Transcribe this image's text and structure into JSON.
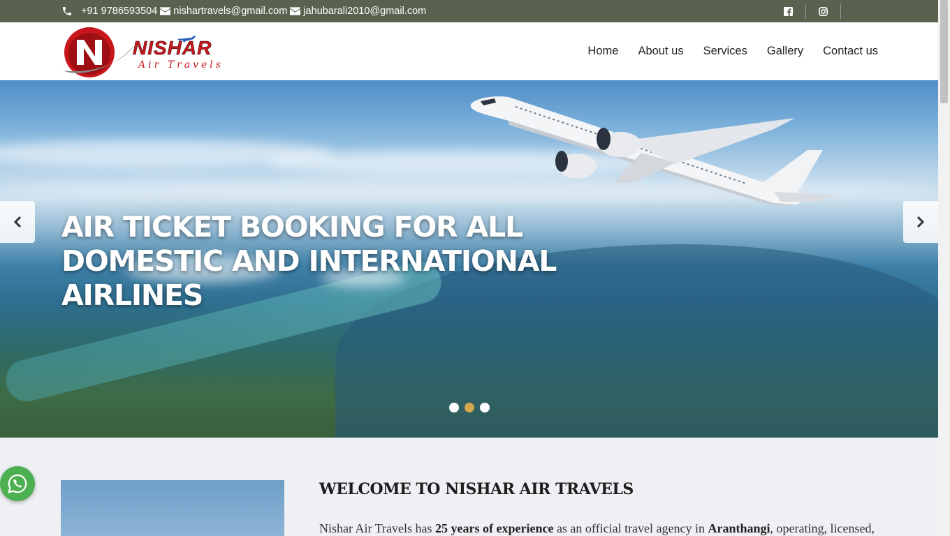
{
  "topbar": {
    "phone": "+91 9786593504",
    "email1": "nishartravels@gmail.com",
    "email2": "jahubarali2010@gmail.com",
    "social": [
      "facebook-icon",
      "instagram-icon"
    ]
  },
  "logo": {
    "brand": "NISHAR",
    "tagline": "Air Travels"
  },
  "nav": {
    "items": [
      "Home",
      "About us",
      "Services",
      "Gallery",
      "Contact us"
    ]
  },
  "hero": {
    "headline": "AIR TICKET BOOKING FOR ALL DOMESTIC AND INTERNATIONAL AIRLINES",
    "slides": 3,
    "active_slide": 2
  },
  "about": {
    "title": "WELCOME TO NISHAR AIR TRAVELS",
    "text_prefix": "Nishar Air Travels has ",
    "text_bold1": "25 years of experience",
    "text_mid": " as an official travel agency in ",
    "text_bold2": "Aranthangi",
    "text_suffix": ", operating, licensed,"
  },
  "colors": {
    "topbar_bg": "#59624f",
    "brand_red": "#c8161d",
    "active_dot": "#d4a84f",
    "whatsapp": "#4caf50"
  }
}
